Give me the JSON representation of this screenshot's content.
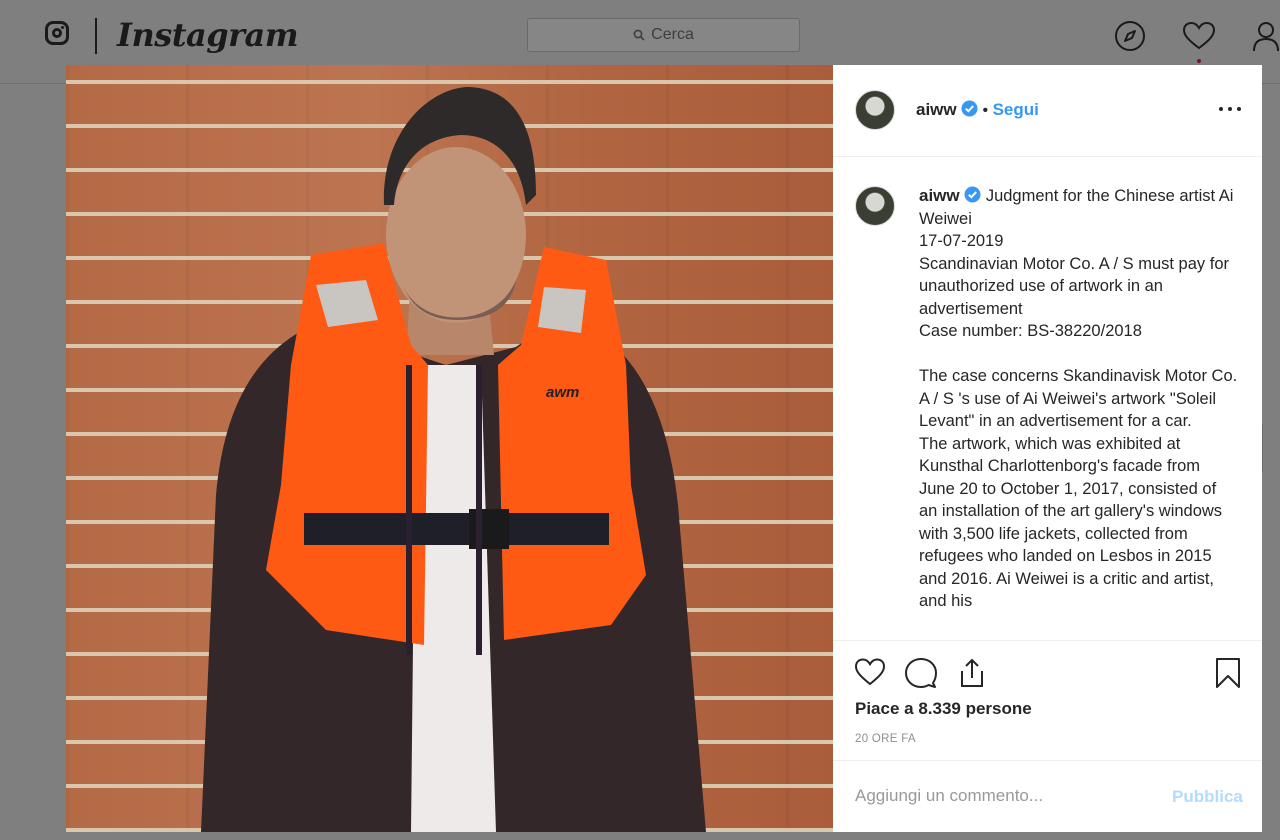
{
  "header": {
    "wordmark": "Instagram",
    "search_placeholder": "Cerca"
  },
  "post": {
    "username": "aiww",
    "separator": "•",
    "follow_label": "Segui",
    "photo_alt": "Ai Weiwei standing in an orange life jacket in front of a brick wall",
    "caption_lines": [
      "Judgment for the Chinese artist Ai Weiwei",
      "17-07-2019",
      "Scandinavian Motor Co. A / S must pay for unauthorized use of artwork in an advertisement",
      "Case number: BS-38220/2018",
      "The case concerns Skandinavisk Motor Co. A / S 's use of Ai Weiwei's artwork \"Soleil Levant\" in an advertisement for a car.",
      "The artwork, which was exhibited at Kunsthal Charlottenborg's facade from June 20 to October 1, 2017, consisted of an installation of the art gallery's windows with 3,500 life jackets, collected from refugees who landed on Lesbos in 2015 and 2016. Ai Weiwei is a critic and artist, and his"
    ],
    "likes": "Piace a 8.339 persone",
    "time_ago": "20 ORE FA",
    "comment_placeholder": "Aggiungi un commento...",
    "publish_label": "Pubblica"
  },
  "colors": {
    "accent": "#3897f0",
    "publish_disabled": "#b3dbff",
    "text": "#262626",
    "muted": "#8e8e8e",
    "overlay": "#7f7f7f"
  },
  "icons": [
    "instagram-glyph-icon",
    "search-icon",
    "compass-icon",
    "heart-icon",
    "profile-icon",
    "verified-badge-icon",
    "more-options-icon",
    "like-icon",
    "comment-icon",
    "share-icon",
    "bookmark-icon"
  ]
}
